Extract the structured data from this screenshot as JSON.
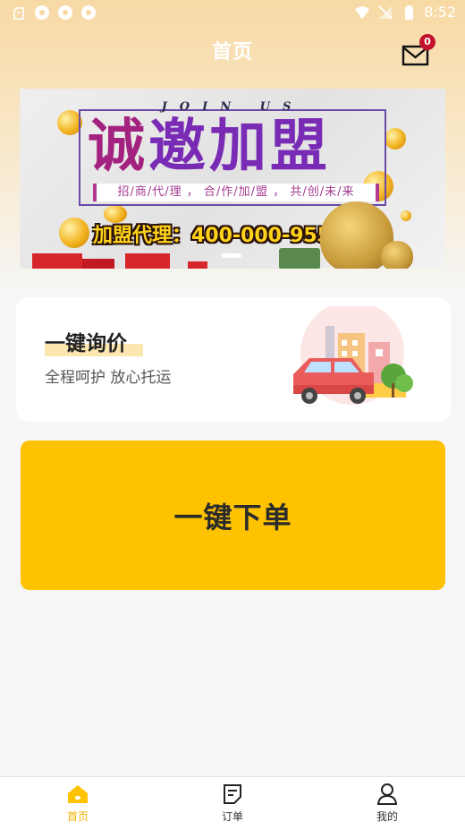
{
  "status_bar": {
    "time": "8:52"
  },
  "header": {
    "title": "首页",
    "mail_badge": "0"
  },
  "banner": {
    "join_us": "JOIN US",
    "headline": [
      "诚",
      "邀",
      "加",
      "盟"
    ],
    "subline": "招/商/代/理 ， 合/作/加/盟 ， 共/创/未/来",
    "phone_line": "加盟代理：400-000-9558"
  },
  "inquiry_card": {
    "title": "一键询价",
    "subtitle": "全程呵护 放心托运"
  },
  "order_button": {
    "label": "一键下单"
  },
  "bottom_nav": {
    "items": [
      {
        "label": "首页",
        "icon": "home-icon",
        "active": true
      },
      {
        "label": "订单",
        "icon": "order-icon",
        "active": false
      },
      {
        "label": "我的",
        "icon": "profile-icon",
        "active": false
      }
    ]
  },
  "colors": {
    "accent": "#fec200",
    "active_nav": "#f0b400",
    "badge": "#c4122c"
  }
}
